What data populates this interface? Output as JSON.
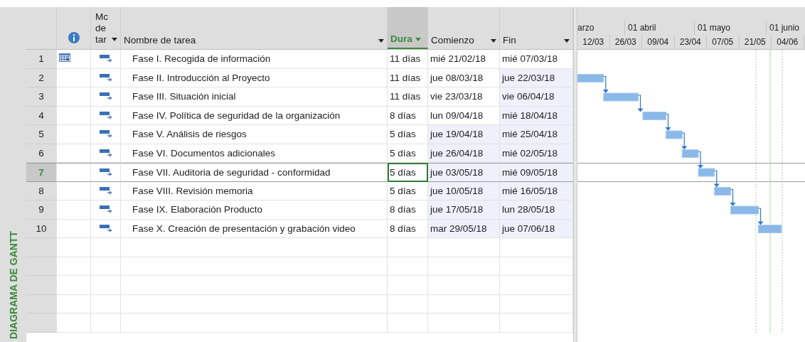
{
  "view_label": "DIAGRAMA DE GANTT",
  "columns": [
    {
      "kind": "indicators",
      "selected": false
    },
    {
      "kind": "mode",
      "label": "Mc de tar",
      "selected": false
    },
    {
      "kind": "name",
      "label": "Nombre de tarea",
      "selected": false
    },
    {
      "kind": "duration",
      "label": "Dura",
      "selected": true
    },
    {
      "kind": "start",
      "label": "Comienzo",
      "selected": false
    },
    {
      "kind": "finish",
      "label": "Fin",
      "selected": false
    }
  ],
  "timescale": {
    "months": [
      "arzo",
      "01 abril",
      "01 mayo",
      "01 junio"
    ],
    "weeks": [
      "12/03",
      "26/03",
      "09/04",
      "23/04",
      "07/05",
      "21/05",
      "04/06"
    ]
  },
  "tasks": [
    {
      "id": "1",
      "calendar_indicator": true,
      "name": "Fase I. Recogida de información",
      "duration": "11 días",
      "start": "mié 21/02/18",
      "finish": "mié 07/03/18",
      "selected": false,
      "start_highlighted": false,
      "finish_highlighted": false
    },
    {
      "id": "2",
      "calendar_indicator": false,
      "name": "Fase II. Introducción al Proyecto",
      "duration": "11 días",
      "start": "jue 08/03/18",
      "finish": "jue 22/03/18",
      "selected": false,
      "start_highlighted": false,
      "finish_highlighted": true
    },
    {
      "id": "3",
      "calendar_indicator": false,
      "name": "Fase III. Situación inicial",
      "duration": "11 días",
      "start": "vie 23/03/18",
      "finish": "vie 06/04/18",
      "selected": false,
      "start_highlighted": false,
      "finish_highlighted": true
    },
    {
      "id": "4",
      "calendar_indicator": false,
      "name": "Fase IV. Política de seguridad de la organización",
      "duration": "8 días",
      "start": "lun 09/04/18",
      "finish": "mié 18/04/18",
      "selected": false,
      "start_highlighted": false,
      "finish_highlighted": true
    },
    {
      "id": "5",
      "calendar_indicator": false,
      "name": "Fase V. Análisis de riesgos",
      "duration": "5 días",
      "start": "jue 19/04/18",
      "finish": "mié 25/04/18",
      "selected": false,
      "start_highlighted": true,
      "finish_highlighted": true
    },
    {
      "id": "6",
      "calendar_indicator": false,
      "name": "Fase VI. Documentos adicionales",
      "duration": "5 días",
      "start": "jue 26/04/18",
      "finish": "mié 02/05/18",
      "selected": false,
      "start_highlighted": true,
      "finish_highlighted": true
    },
    {
      "id": "7",
      "calendar_indicator": false,
      "name": "Fase VII. Auditoria de seguridad - conformidad",
      "duration": "5 días",
      "start": "jue 03/05/18",
      "finish": "mié 09/05/18",
      "selected": true,
      "start_highlighted": true,
      "finish_highlighted": true
    },
    {
      "id": "8",
      "calendar_indicator": false,
      "name": "Fase VIII. Revisión memoria",
      "duration": "5 días",
      "start": "jue 10/05/18",
      "finish": "mié 16/05/18",
      "selected": false,
      "start_highlighted": true,
      "finish_highlighted": true
    },
    {
      "id": "9",
      "calendar_indicator": false,
      "name": "Fase IX. Elaboración Producto",
      "duration": "8 días",
      "start": "jue 17/05/18",
      "finish": "lun 28/05/18",
      "selected": false,
      "start_highlighted": true,
      "finish_highlighted": true
    },
    {
      "id": "10",
      "calendar_indicator": false,
      "name": "Fase X. Creación de presentación y grabación video",
      "duration": "8 días",
      "start": "mar 29/05/18",
      "finish": "jue 07/06/18",
      "selected": false,
      "start_highlighted": true,
      "finish_highlighted": true
    }
  ]
}
